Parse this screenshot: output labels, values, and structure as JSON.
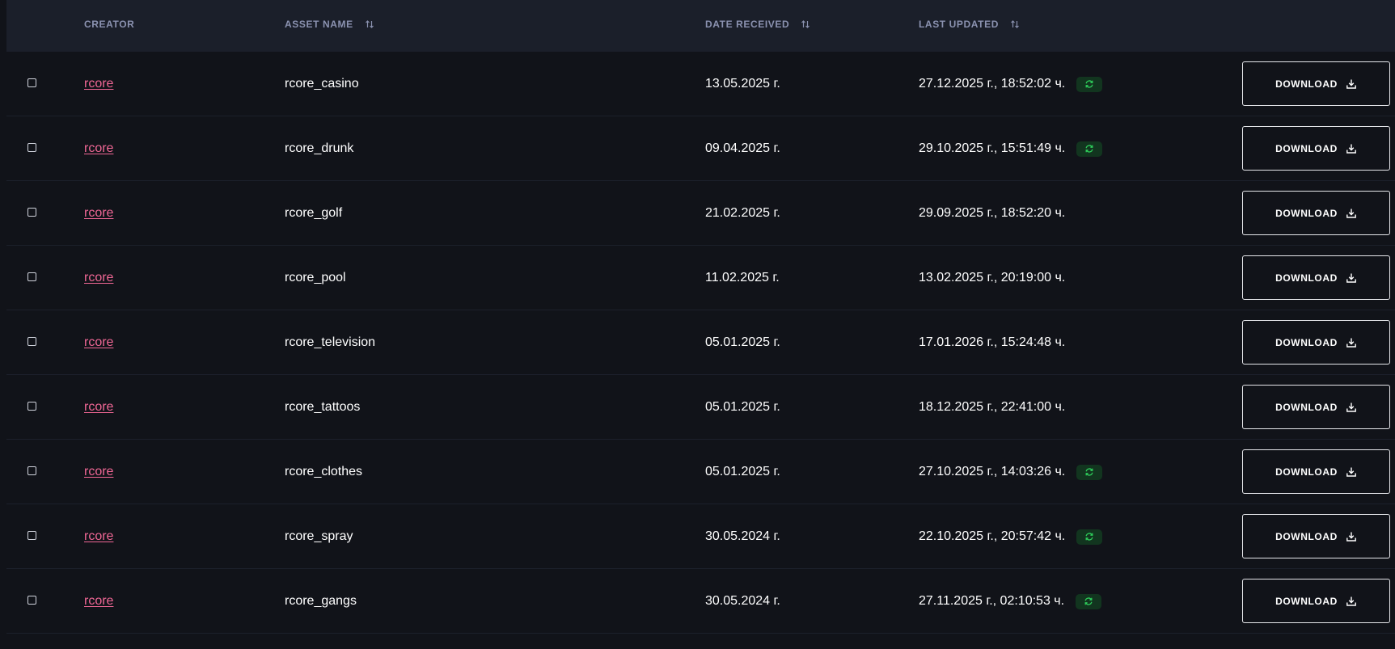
{
  "table": {
    "columns": {
      "creator": "CREATOR",
      "asset_name": "ASSET NAME",
      "date_received": "DATE RECEIVED",
      "last_updated": "LAST UPDATED"
    },
    "sort_icon": "sort-arrows-icon",
    "download_label": "DOWNLOAD",
    "download_icon": "download-icon",
    "sync_icon": "refresh-icon",
    "colors": {
      "background": "#111319",
      "header_background": "#1b1f2a",
      "header_text": "#8b92b0",
      "creator_link": "#f06795",
      "sync_badge_bg": "#12351f",
      "sync_badge_icon": "#2ecc5a"
    },
    "rows": [
      {
        "creator": "rcore",
        "asset": "rcore_casino",
        "received": "13.05.2025 г.",
        "updated": "27.12.2025 г., 18:52:02 ч.",
        "sync": true
      },
      {
        "creator": "rcore",
        "asset": "rcore_drunk",
        "received": "09.04.2025 г.",
        "updated": "29.10.2025 г., 15:51:49 ч.",
        "sync": true
      },
      {
        "creator": "rcore",
        "asset": "rcore_golf",
        "received": "21.02.2025 г.",
        "updated": "29.09.2025 г., 18:52:20 ч.",
        "sync": false
      },
      {
        "creator": "rcore",
        "asset": "rcore_pool",
        "received": "11.02.2025 г.",
        "updated": "13.02.2025 г., 20:19:00 ч.",
        "sync": false
      },
      {
        "creator": "rcore",
        "asset": "rcore_television",
        "received": "05.01.2025 г.",
        "updated": "17.01.2026 г., 15:24:48 ч.",
        "sync": false
      },
      {
        "creator": "rcore",
        "asset": "rcore_tattoos",
        "received": "05.01.2025 г.",
        "updated": "18.12.2025 г., 22:41:00 ч.",
        "sync": false
      },
      {
        "creator": "rcore",
        "asset": "rcore_clothes",
        "received": "05.01.2025 г.",
        "updated": "27.10.2025 г., 14:03:26 ч.",
        "sync": true
      },
      {
        "creator": "rcore",
        "asset": "rcore_spray",
        "received": "30.05.2024 г.",
        "updated": "22.10.2025 г., 20:57:42 ч.",
        "sync": true
      },
      {
        "creator": "rcore",
        "asset": "rcore_gangs",
        "received": "30.05.2024 г.",
        "updated": "27.11.2025 г., 02:10:53 ч.",
        "sync": true
      }
    ]
  }
}
